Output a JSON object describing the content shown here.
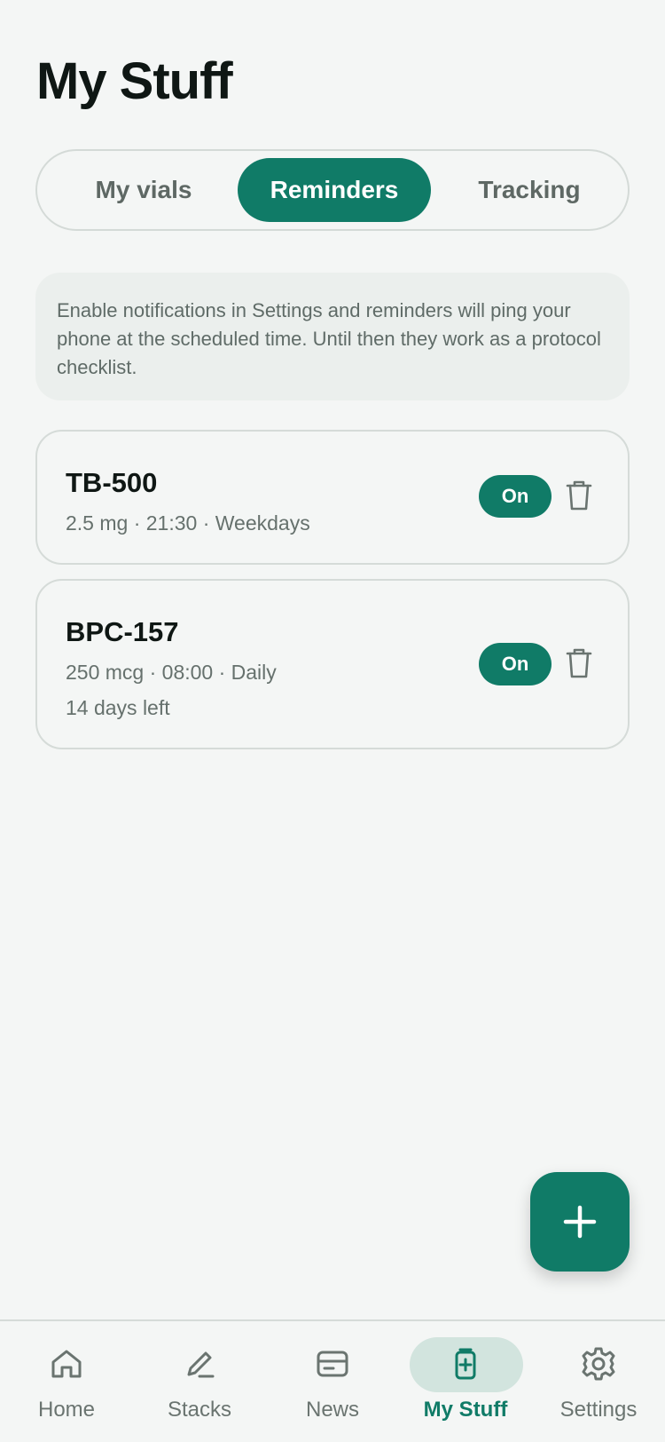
{
  "page": {
    "title": "My Stuff"
  },
  "tabs": [
    {
      "label": "My vials",
      "active": false
    },
    {
      "label": "Reminders",
      "active": true
    },
    {
      "label": "Tracking",
      "active": false
    }
  ],
  "info_banner": {
    "text": "Enable notifications in Settings and reminders will ping your phone at the scheduled time. Until then they work as a protocol checklist."
  },
  "reminders": [
    {
      "name": "TB-500",
      "details": "2.5 mg · 21:30 · Weekdays",
      "extra": "",
      "toggle_label": "On",
      "icon": "trash-icon"
    },
    {
      "name": "BPC-157",
      "details": "250 mcg · 08:00 · Daily",
      "extra": "14 days left",
      "toggle_label": "On",
      "icon": "trash-icon"
    }
  ],
  "fab": {
    "icon": "plus-icon"
  },
  "bottom_nav": [
    {
      "label": "Home",
      "icon": "home-icon",
      "active": false
    },
    {
      "label": "Stacks",
      "icon": "pencil-icon",
      "active": false
    },
    {
      "label": "News",
      "icon": "news-card-icon",
      "active": false
    },
    {
      "label": "My Stuff",
      "icon": "vial-plus-icon",
      "active": true
    },
    {
      "label": "Settings",
      "icon": "gear-icon",
      "active": false
    }
  ],
  "colors": {
    "accent": "#107b67",
    "background": "#f4f6f5",
    "active_nav_pill": "#d2e4de",
    "muted_text": "#66716d"
  }
}
